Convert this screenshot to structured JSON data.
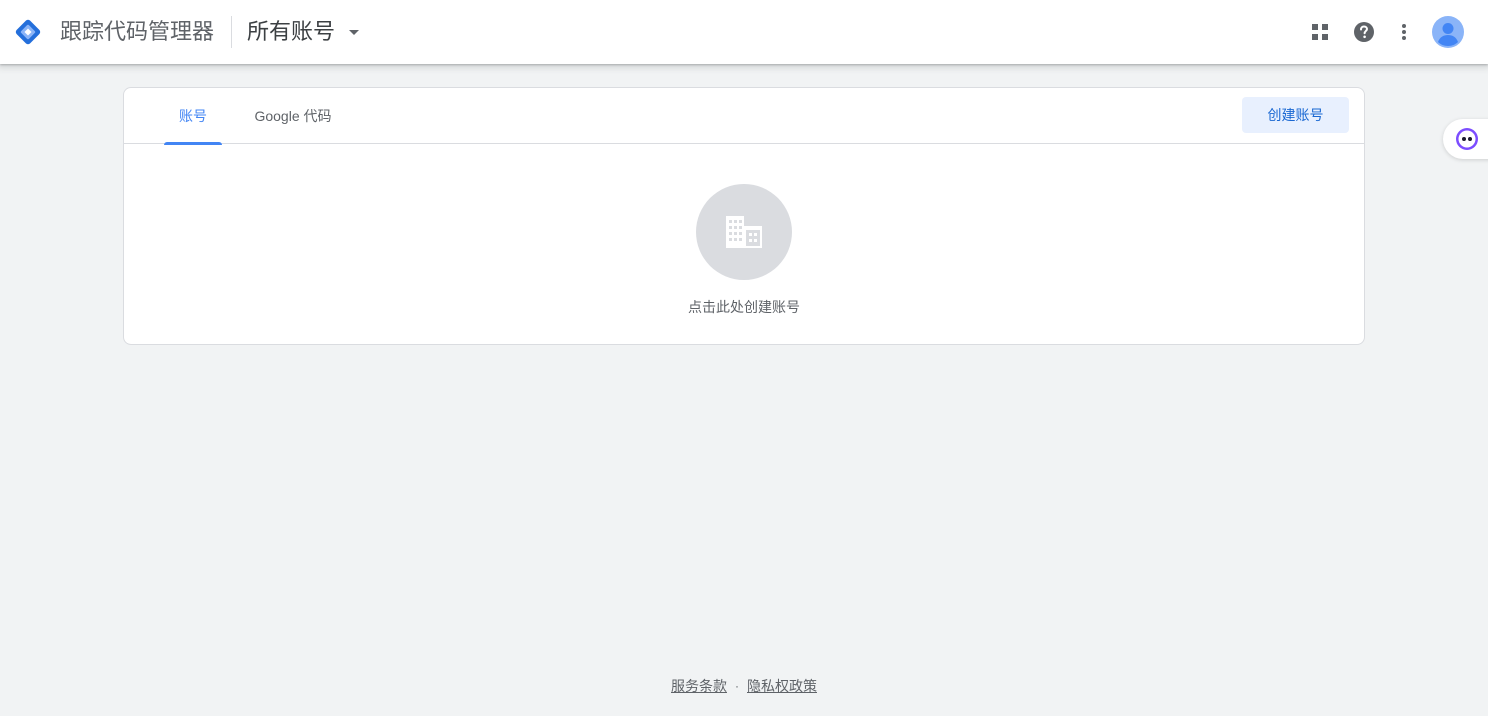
{
  "header": {
    "app_title": "跟踪代码管理器",
    "account_picker_label": "所有账号",
    "icons": [
      "tag-manager-logo-icon",
      "apps-grid-icon",
      "help-icon",
      "more-vert-icon",
      "account-avatar-icon"
    ]
  },
  "tabs": [
    {
      "label": "账号",
      "active": true
    },
    {
      "label": "Google 代码",
      "active": false
    }
  ],
  "create_account_button": "创建账号",
  "empty_state": {
    "icon": "building-icon",
    "text": "点击此处创建账号"
  },
  "side_widget": {
    "icon": "assistant-face-icon"
  },
  "footer": {
    "terms": "服务条款",
    "separator": "·",
    "privacy": "隐私权政策"
  },
  "colors": {
    "accent": "#4285f4",
    "logo_dark": "#246fdb",
    "logo_light": "#8ab4f8",
    "background": "#f1f3f4",
    "button_bg": "#e8f0fe",
    "button_text": "#1967d2"
  }
}
